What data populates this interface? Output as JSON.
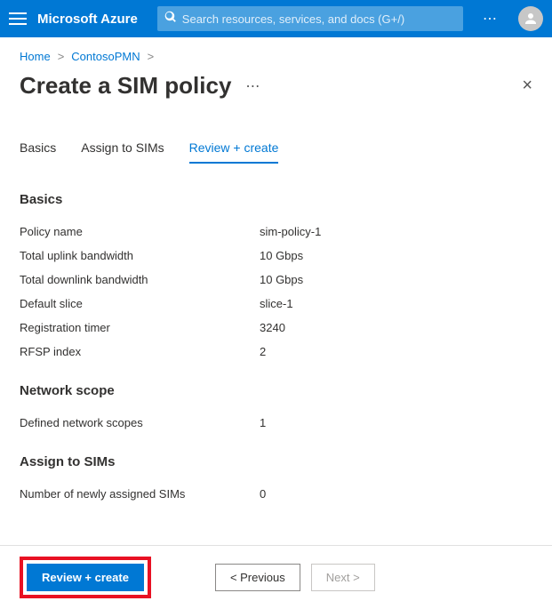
{
  "topbar": {
    "brand": "Microsoft Azure",
    "search_placeholder": "Search resources, services, and docs (G+/)",
    "more": "⋯"
  },
  "breadcrumb": {
    "home": "Home",
    "item": "ContosoPMN",
    "sep": ">"
  },
  "page": {
    "title": "Create a SIM policy",
    "more": "⋯",
    "close": "×"
  },
  "tabs": {
    "t0": "Basics",
    "t1": "Assign to SIMs",
    "t2": "Review + create"
  },
  "sections": {
    "basics_title": "Basics",
    "network_title": "Network scope",
    "assign_title": "Assign to SIMs"
  },
  "fields": {
    "policy_name_label": "Policy name",
    "policy_name_value": "sim-policy-1",
    "uplink_label": "Total uplink bandwidth",
    "uplink_value": "10 Gbps",
    "downlink_label": "Total downlink bandwidth",
    "downlink_value": "10 Gbps",
    "slice_label": "Default slice",
    "slice_value": "slice-1",
    "reg_timer_label": "Registration timer",
    "reg_timer_value": "3240",
    "rfsp_label": "RFSP index",
    "rfsp_value": "2",
    "scopes_label": "Defined network scopes",
    "scopes_value": "1",
    "sims_label": "Number of newly assigned SIMs",
    "sims_value": "0"
  },
  "footer": {
    "review": "Review + create",
    "previous": "<  Previous",
    "next": "Next  >"
  }
}
